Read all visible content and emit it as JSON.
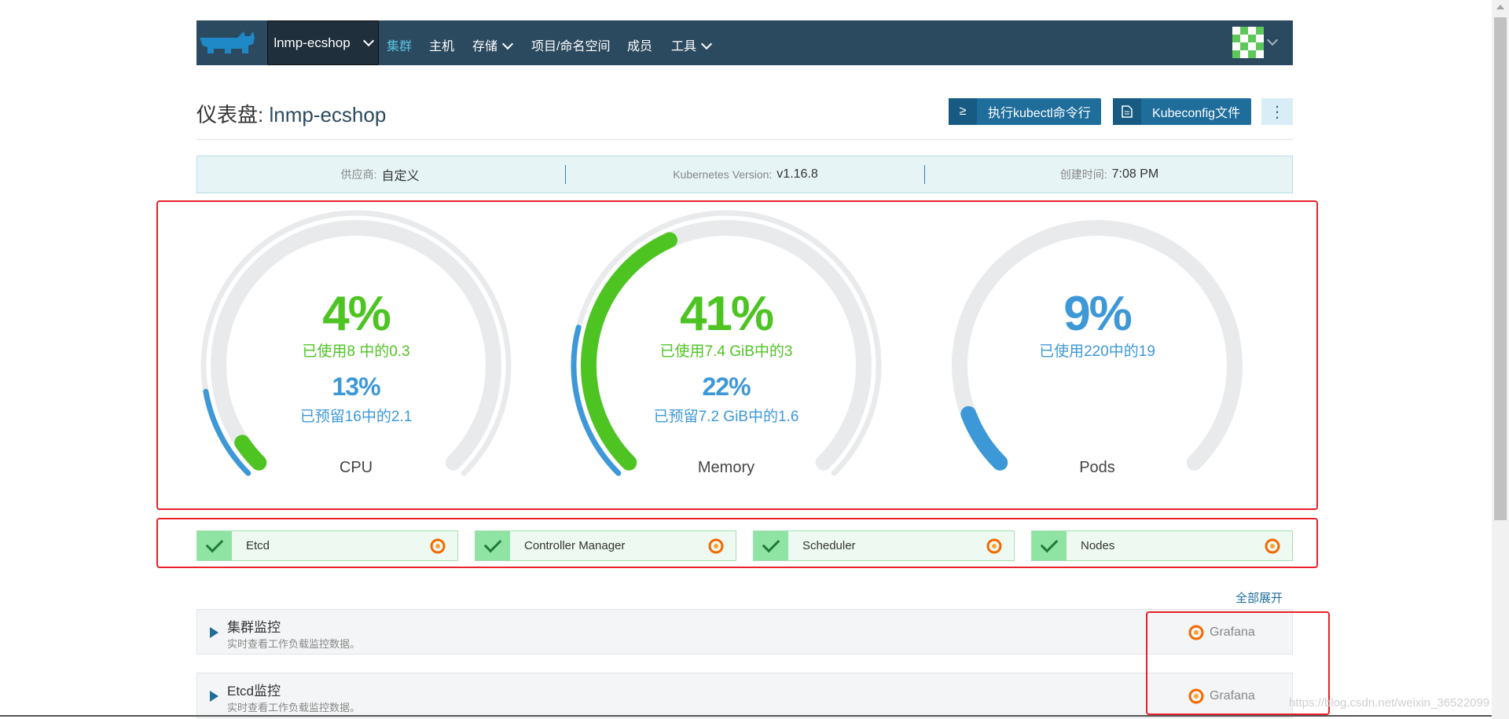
{
  "header": {
    "cluster_name": "lnmp-ecshop",
    "nav": [
      {
        "label": "集群",
        "active": true,
        "dropdown": false
      },
      {
        "label": "主机",
        "active": false,
        "dropdown": false
      },
      {
        "label": "存储",
        "active": false,
        "dropdown": true
      },
      {
        "label": "项目/命名空间",
        "active": false,
        "dropdown": false
      },
      {
        "label": "成员",
        "active": false,
        "dropdown": false
      },
      {
        "label": "工具",
        "active": false,
        "dropdown": true
      }
    ],
    "brand_color": "#2c4a5f"
  },
  "page": {
    "title_prefix": "仪表盘: ",
    "title_name": "lnmp-ecshop",
    "kubectl_button": "执行kubectl命令行",
    "kubeconfig_button": "Kubeconfig文件",
    "more_icon": "⋮"
  },
  "info": {
    "provider_label": "供应商:",
    "provider_value": "自定义",
    "k8s_label": "Kubernetes Version:",
    "k8s_value": "v1.16.8",
    "created_label": "创建时间:",
    "created_value": "7:08 PM"
  },
  "gauges": {
    "cpu": {
      "used_pct": "4%",
      "used_text": "已使用8 中的0.3",
      "reserved_pct": "13%",
      "reserved_text": "已预留16中的2.1",
      "label": "CPU",
      "used_fraction": 0.04,
      "reserved_fraction": 0.13
    },
    "memory": {
      "used_pct": "41%",
      "used_text": "已使用7.4 GiB中的3",
      "reserved_pct": "22%",
      "reserved_text": "已预留7.2 GiB中的1.6",
      "label": "Memory",
      "used_fraction": 0.41,
      "reserved_fraction": 0.22
    },
    "pods": {
      "used_pct": "9%",
      "used_text": "已使用220中的19",
      "label": "Pods",
      "used_fraction": 0.09
    },
    "colors": {
      "used": "#4ec423",
      "reserved": "#3d98d8",
      "track": "#e8eaec"
    }
  },
  "components": [
    {
      "label": "Etcd",
      "status": "ok"
    },
    {
      "label": "Controller Manager",
      "status": "ok"
    },
    {
      "label": "Scheduler",
      "status": "ok"
    },
    {
      "label": "Nodes",
      "status": "ok"
    }
  ],
  "monitoring": {
    "expand_all": "全部展开",
    "panels": [
      {
        "title": "集群监控",
        "desc": "实时查看工作负载监控数据。",
        "link": "Grafana"
      },
      {
        "title": "Etcd监控",
        "desc": "实时查看工作负载监控数据。",
        "link": "Grafana"
      }
    ]
  },
  "watermark": "https://blog.csdn.net/weixin_36522099"
}
